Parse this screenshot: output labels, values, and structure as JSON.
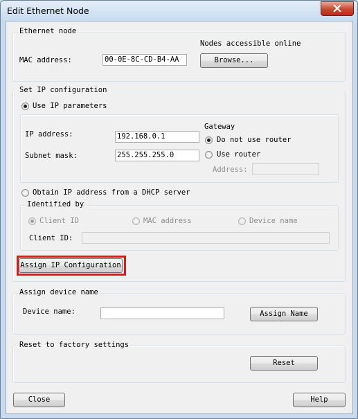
{
  "window": {
    "title": "Edit Ethernet Node"
  },
  "ethernet_node": {
    "legend": "Ethernet node",
    "mac_label": "MAC address:",
    "mac_value": "00-0E-8C-CD-B4-AA",
    "nodes_online_label": "Nodes accessible online",
    "browse_button": "Browse..."
  },
  "ip_config": {
    "legend": "Set IP configuration",
    "use_ip_params": "Use IP parameters",
    "ip_label": "IP address:",
    "ip_value": "192.168.0.1",
    "subnet_label": "Subnet mask:",
    "subnet_value": "255.255.255.0",
    "gateway_label": "Gateway",
    "no_router": "Do not use router",
    "use_router": "Use router",
    "router_address_label": "Address:",
    "router_address_value": "",
    "dhcp": "Obtain IP address from a DHCP server",
    "identified_by": {
      "legend": "Identified by",
      "client_id": "Client ID",
      "mac_address": "MAC address",
      "device_name": "Device name",
      "client_id_label": "Client ID:",
      "client_id_value": ""
    },
    "assign_button": "Assign IP Configuration"
  },
  "device_name_group": {
    "legend": "Assign device name",
    "label": "Device name:",
    "value": "",
    "assign_button": "Assign Name"
  },
  "factory": {
    "legend": "Reset to factory settings",
    "reset_button": "Reset"
  },
  "footer": {
    "close_button": "Close",
    "help_button": "Help"
  },
  "colors": {
    "highlight": "#d41d1d",
    "titlebar": "#c7daef",
    "close_button": "#c7462f"
  }
}
